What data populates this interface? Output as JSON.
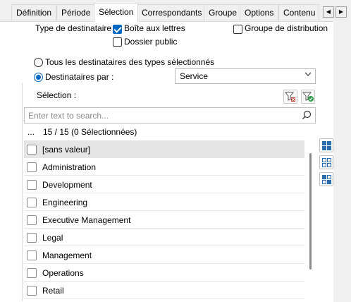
{
  "tabs": [
    {
      "label": "Définition"
    },
    {
      "label": "Période"
    },
    {
      "label": "Sélection"
    },
    {
      "label": "Correspondants"
    },
    {
      "label": "Groupe"
    },
    {
      "label": "Options"
    },
    {
      "label": "Contenu"
    }
  ],
  "tab_nav": {
    "prev_icon": "chevron-left-icon",
    "next_icon": "chevron-right-icon",
    "prev": "◀",
    "next": "▶"
  },
  "recipient_type": {
    "label": "Type de destinataire :",
    "options": [
      {
        "label": "Boîte aux lettres",
        "checked": true
      },
      {
        "label": "Dossier public",
        "checked": false
      },
      {
        "label": "Groupe de distribution",
        "checked": false
      }
    ]
  },
  "radios": {
    "all": {
      "label": "Tous les destinataires des types sélectionnés",
      "checked": false
    },
    "by": {
      "label": "Destinataires par :",
      "checked": true
    }
  },
  "by_select": {
    "value": "Service"
  },
  "selection": {
    "label": "Sélection :",
    "search_placeholder": "Enter text to search...",
    "header_dots": "...",
    "header_count": "15 / 15 (0 Sélectionnées)"
  },
  "list": [
    {
      "label": "[sans valeur]",
      "highlighted": true
    },
    {
      "label": "Administration"
    },
    {
      "label": "Development"
    },
    {
      "label": "Engineering"
    },
    {
      "label": "Executive Management"
    },
    {
      "label": "Legal"
    },
    {
      "label": "Management"
    },
    {
      "label": "Operations"
    },
    {
      "label": "Retail"
    }
  ],
  "colors": {
    "accent": "#0067c0",
    "icon_blue": "#2b6cb0",
    "icon_green": "#2e9e4a"
  }
}
